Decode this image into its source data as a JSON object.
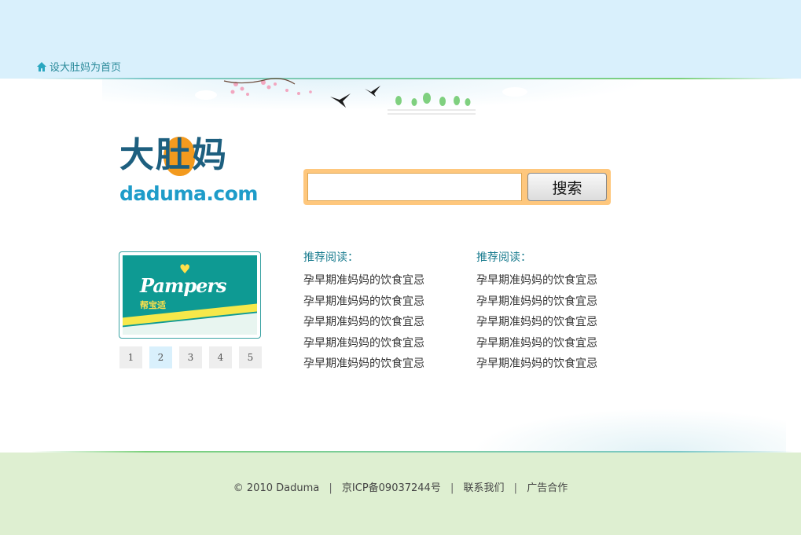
{
  "header": {
    "home_link": "设大肚妈为首页",
    "icon": "home-icon"
  },
  "logo": {
    "chinese": "大肚妈",
    "domain": "daduma.com"
  },
  "search": {
    "value": "",
    "button_label": "搜索"
  },
  "ad": {
    "brand": "Pampers",
    "brand_cn": "帮宝适"
  },
  "pager": {
    "pages": [
      "1",
      "2",
      "3",
      "4",
      "5"
    ],
    "active": "2"
  },
  "recommend": [
    {
      "title": "推荐阅读：",
      "items": [
        "孕早期准妈妈的饮食宜忌",
        "孕早期准妈妈的饮食宜忌",
        "孕早期准妈妈的饮食宜忌",
        "孕早期准妈妈的饮食宜忌",
        "孕早期准妈妈的饮食宜忌"
      ]
    },
    {
      "title": "推荐阅读：",
      "items": [
        "孕早期准妈妈的饮食宜忌",
        "孕早期准妈妈的饮食宜忌",
        "孕早期准妈妈的饮食宜忌",
        "孕早期准妈妈的饮食宜忌",
        "孕早期准妈妈的饮食宜忌"
      ]
    }
  ],
  "footer": {
    "copyright": "© 2010 Daduma",
    "icp": "京ICP备09037244号",
    "contact": "联系我们",
    "ads": "广告合作",
    "separator": "|"
  },
  "colors": {
    "top_band": "#d9f0fc",
    "footer_band": "#deefd1",
    "search_border": "#fec77d",
    "link_teal": "#1a7c8f",
    "logo_blue": "#1e9cc9",
    "logo_orange": "#f39a1e"
  }
}
